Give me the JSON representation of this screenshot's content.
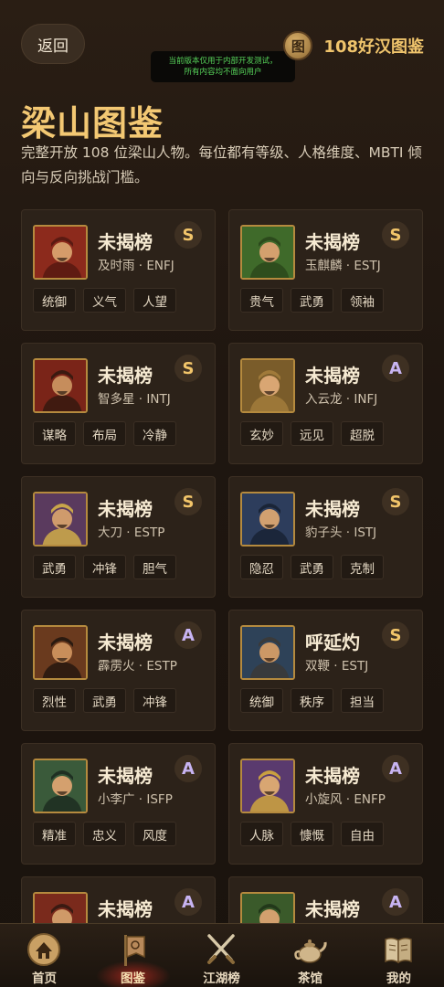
{
  "header": {
    "back_label": "返回",
    "guide_icon_char": "图",
    "guide_title": "108好汉图鉴",
    "notice_line1": "当前版本仅用于内部开发测试，",
    "notice_line2": "所有内容均不面向用户"
  },
  "page": {
    "title": "梁山图鉴",
    "description": "完整开放 108 位梁山人物。每位都有等级、人格维度、MBTI 倾向与反向挑战门槛。"
  },
  "cards": [
    {
      "name": "未揭榜",
      "sub": "及时雨 · ENFJ",
      "grade": "S",
      "tags": [
        "统御",
        "义气",
        "人望"
      ],
      "avatar_bg": "#8c2a1c",
      "avatar_skin": "#d59c6a",
      "avatar_hat": "#5a1a12"
    },
    {
      "name": "未揭榜",
      "sub": "玉麒麟 · ESTJ",
      "grade": "S",
      "tags": [
        "贵气",
        "武勇",
        "领袖"
      ],
      "avatar_bg": "#3f6a2a",
      "avatar_skin": "#d4a06e",
      "avatar_hat": "#2c4a1c"
    },
    {
      "name": "未揭榜",
      "sub": "智多星 · INTJ",
      "grade": "S",
      "tags": [
        "谋略",
        "布局",
        "冷静"
      ],
      "avatar_bg": "#7a2418",
      "avatar_skin": "#c68d5c",
      "avatar_hat": "#3a1a10"
    },
    {
      "name": "未揭榜",
      "sub": "入云龙 · INFJ",
      "grade": "A",
      "tags": [
        "玄妙",
        "远见",
        "超脱"
      ],
      "avatar_bg": "#7a5c2a",
      "avatar_skin": "#d9a673",
      "avatar_hat": "#a07a3a"
    },
    {
      "name": "未揭榜",
      "sub": "大刀 · ESTP",
      "grade": "S",
      "tags": [
        "武勇",
        "冲锋",
        "胆气"
      ],
      "avatar_bg": "#5a3a5e",
      "avatar_skin": "#cf9b6c",
      "avatar_hat": "#c9a64a"
    },
    {
      "name": "未揭榜",
      "sub": "豹子头 · ISTJ",
      "grade": "S",
      "tags": [
        "隐忍",
        "武勇",
        "克制"
      ],
      "avatar_bg": "#2d3d5c",
      "avatar_skin": "#d1a070",
      "avatar_hat": "#1a2436"
    },
    {
      "name": "未揭榜",
      "sub": "霹雳火 · ESTP",
      "grade": "A",
      "tags": [
        "烈性",
        "武勇",
        "冲锋"
      ],
      "avatar_bg": "#6a3a1e",
      "avatar_skin": "#c98e5a",
      "avatar_hat": "#2a1a10"
    },
    {
      "name": "呼延灼",
      "sub": "双鞭 · ESTJ",
      "grade": "S",
      "tags": [
        "统御",
        "秩序",
        "担当"
      ],
      "avatar_bg": "#2e4258",
      "avatar_skin": "#cc9866",
      "avatar_hat": "#3a3a3a"
    },
    {
      "name": "未揭榜",
      "sub": "小李广 · ISFP",
      "grade": "A",
      "tags": [
        "精准",
        "忠义",
        "风度"
      ],
      "avatar_bg": "#3a5a3a",
      "avatar_skin": "#d4a06e",
      "avatar_hat": "#1f2f22"
    },
    {
      "name": "未揭榜",
      "sub": "小旋风 · ENFP",
      "grade": "A",
      "tags": [
        "人脉",
        "慷慨",
        "自由"
      ],
      "avatar_bg": "#5a3a6e",
      "avatar_skin": "#d8a672",
      "avatar_hat": "#c9a040"
    },
    {
      "name": "未揭榜",
      "sub": "",
      "grade": "A",
      "tags": [],
      "avatar_bg": "#7a2a1c",
      "avatar_skin": "#cf9a68",
      "avatar_hat": "#3a1a12"
    },
    {
      "name": "未揭榜",
      "sub": "",
      "grade": "A",
      "tags": [],
      "avatar_bg": "#3a5a2a",
      "avatar_skin": "#d2a06e",
      "avatar_hat": "#22381a"
    }
  ],
  "tabbar": {
    "items": [
      {
        "label": "首页",
        "icon": "home-icon",
        "active": false
      },
      {
        "label": "图鉴",
        "icon": "banner-icon",
        "active": true
      },
      {
        "label": "江湖榜",
        "icon": "crossed-swords-icon",
        "active": false
      },
      {
        "label": "茶馆",
        "icon": "teapot-icon",
        "active": false
      },
      {
        "label": "我的",
        "icon": "book-icon",
        "active": false
      }
    ]
  },
  "colors": {
    "accent_gold": "#f3c873",
    "grade_s": "#f2c56a",
    "grade_a": "#c8b4f2",
    "notice_green": "#57d35a",
    "tab_active_glow": "#aa281e"
  }
}
